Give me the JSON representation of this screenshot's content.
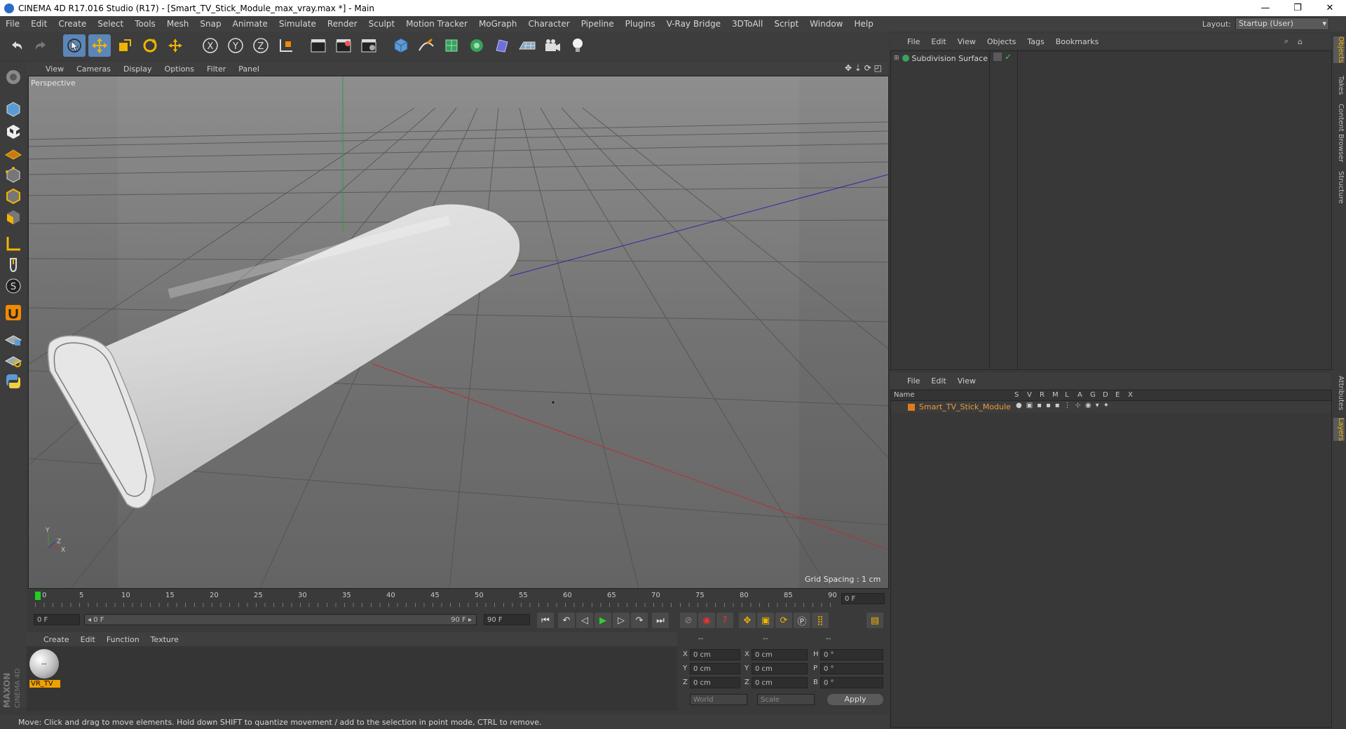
{
  "window": {
    "title": "CINEMA 4D R17.016 Studio (R17) - [Smart_TV_Stick_Module_max_vray.max *] - Main",
    "controls": [
      "—",
      "❐",
      "✕"
    ]
  },
  "menubar": {
    "items": [
      "File",
      "Edit",
      "Create",
      "Select",
      "Tools",
      "Mesh",
      "Snap",
      "Animate",
      "Simulate",
      "Render",
      "Sculpt",
      "Motion Tracker",
      "MoGraph",
      "Character",
      "Pipeline",
      "Plugins",
      "V-Ray Bridge",
      "3DToAll",
      "Script",
      "Window",
      "Help"
    ],
    "layout_label": "Layout:",
    "layout_value": "Startup (User)"
  },
  "viewport": {
    "menu": [
      "View",
      "Cameras",
      "Display",
      "Options",
      "Filter",
      "Panel"
    ],
    "label": "Perspective",
    "grid_spacing": "Grid Spacing : 1 cm",
    "axis_labels": {
      "y": "Y",
      "z": "Z",
      "x": "X"
    }
  },
  "timeline": {
    "ticks": [
      "0",
      "5",
      "10",
      "15",
      "20",
      "25",
      "30",
      "35",
      "40",
      "45",
      "50",
      "55",
      "60",
      "65",
      "70",
      "75",
      "80",
      "85",
      "90"
    ],
    "current_frame": "0 F",
    "start_field": "0 F",
    "range_start": "◂ 0 F",
    "range_end": "90 F ▸",
    "end_field": "90 F"
  },
  "material": {
    "menu": [
      "Create",
      "Edit",
      "Function",
      "Texture"
    ],
    "swatch_name": "VR_TV"
  },
  "coords": {
    "headers": [
      "--",
      "--",
      "--"
    ],
    "rows": [
      {
        "a": "X",
        "av": "0 cm",
        "b": "X",
        "bv": "0 cm",
        "c": "H",
        "cv": "0 °"
      },
      {
        "a": "Y",
        "av": "0 cm",
        "b": "Y",
        "bv": "0 cm",
        "c": "P",
        "cv": "0 °"
      },
      {
        "a": "Z",
        "av": "0 cm",
        "b": "Z",
        "bv": "0 cm",
        "c": "B",
        "cv": "0 °"
      }
    ],
    "mode1": "World",
    "mode2": "Scale",
    "apply": "Apply"
  },
  "objects_panel": {
    "menu": [
      "File",
      "Edit",
      "View",
      "Objects",
      "Tags",
      "Bookmarks"
    ],
    "items": [
      {
        "name": "Subdivision Surface"
      }
    ]
  },
  "layers_panel": {
    "menu": [
      "File",
      "Edit",
      "View"
    ],
    "header_name": "Name",
    "header_flags": [
      "S",
      "V",
      "R",
      "M",
      "L",
      "A",
      "G",
      "D",
      "E",
      "X"
    ],
    "items": [
      {
        "name": "Smart_TV_Stick_Module",
        "color": "#e07b1c"
      }
    ]
  },
  "right_tabs": [
    "Objects",
    "Takes",
    "Content Browser",
    "Structure",
    "Attributes",
    "Layers"
  ],
  "status": "Move: Click and drag to move elements. Hold down SHIFT to quantize movement / add to the selection in point mode, CTRL to remove.",
  "brand": {
    "line1": "MAXON",
    "line2": "CINEMA 4D"
  },
  "colors": {
    "selected_tool": "#5b86b8",
    "accent_orange": "#e07b1c",
    "viewport_bg": "#6e6e6e"
  }
}
